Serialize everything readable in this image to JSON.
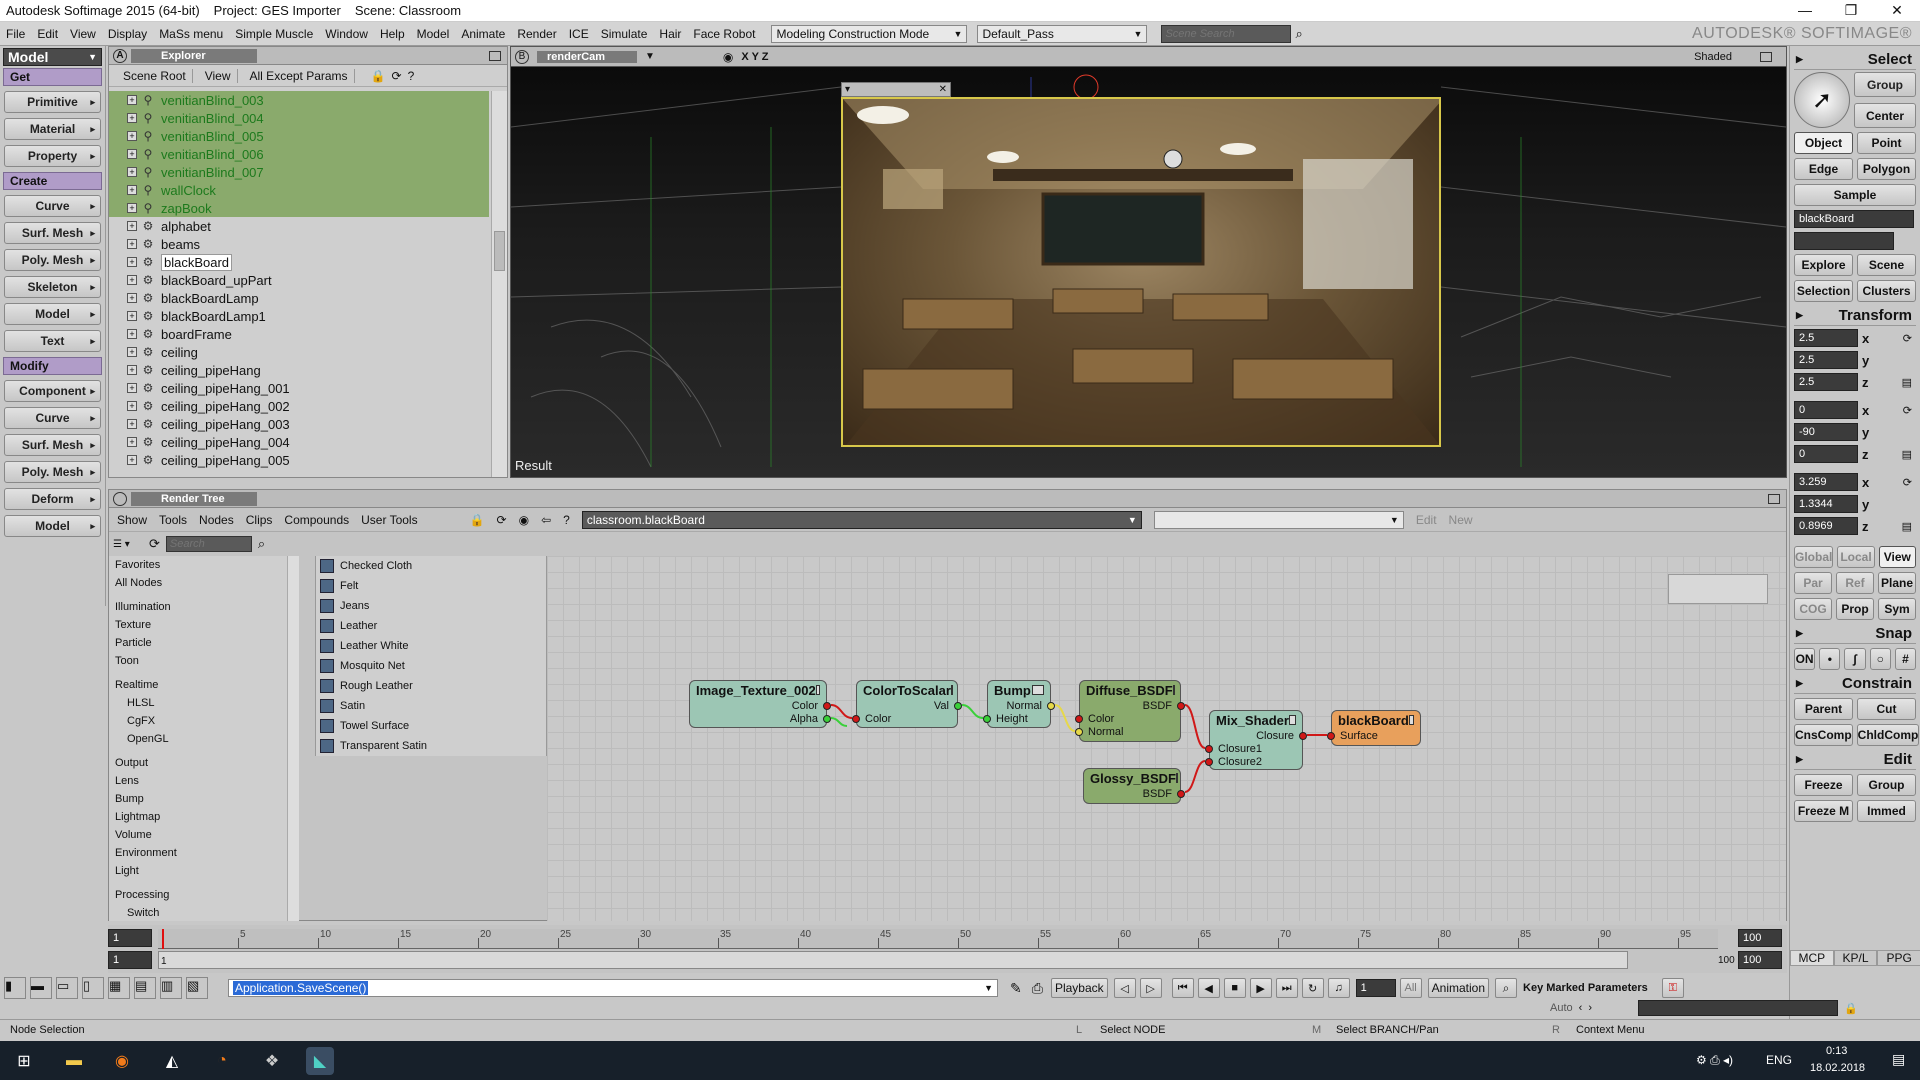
{
  "titlebar": {
    "app": "Autodesk Softimage 2015 (64-bit)",
    "project": "Project: GES Importer",
    "scene": "Scene: Classroom",
    "minimize": "—",
    "maximize": "❐",
    "close": "✕"
  },
  "menubar": {
    "items": [
      "File",
      "Edit",
      "View",
      "Display",
      "MaSs menu",
      "Simple Muscle",
      "Window",
      "Help",
      "Model",
      "Animate",
      "Render",
      "ICE",
      "Simulate",
      "Hair",
      "Face Robot"
    ],
    "mode": "Modeling Construction Mode",
    "pass": "Default_Pass",
    "search_placeholder": "Scene Search",
    "brand": "AUTODESK® SOFTIMAGE®"
  },
  "leftbar": {
    "model_label": "Model",
    "get_label": "Get",
    "get_items": [
      "Primitive",
      "Material",
      "Property"
    ],
    "create_label": "Create",
    "create_items": [
      "Curve",
      "Surf. Mesh",
      "Poly. Mesh",
      "Skeleton",
      "Model",
      "Text"
    ],
    "modify_label": "Modify",
    "modify_items": [
      "Component",
      "Curve",
      "Surf. Mesh",
      "Poly. Mesh",
      "Deform",
      "Model"
    ]
  },
  "explorer": {
    "letter": "A",
    "title": "Explorer",
    "toolbar": [
      "Scene Root",
      "View",
      "All Except Params"
    ],
    "items": [
      {
        "label": "venitianBlind_003",
        "green": true
      },
      {
        "label": "venitianBlind_004",
        "green": true
      },
      {
        "label": "venitianBlind_005",
        "green": true
      },
      {
        "label": "venitianBlind_006",
        "green": true
      },
      {
        "label": "venitianBlind_007",
        "green": true
      },
      {
        "label": "wallClock",
        "green": true
      },
      {
        "label": "zapBook",
        "green": true
      },
      {
        "label": "alphabet",
        "green": false
      },
      {
        "label": "beams",
        "green": false
      },
      {
        "label": "blackBoard",
        "green": false,
        "selected": true
      },
      {
        "label": "blackBoard_upPart",
        "green": false
      },
      {
        "label": "blackBoardLamp",
        "green": false
      },
      {
        "label": "blackBoardLamp1",
        "green": false
      },
      {
        "label": "boardFrame",
        "green": false
      },
      {
        "label": "ceiling",
        "green": false
      },
      {
        "label": "ceiling_pipeHang",
        "green": false
      },
      {
        "label": "ceiling_pipeHang_001",
        "green": false
      },
      {
        "label": "ceiling_pipeHang_002",
        "green": false
      },
      {
        "label": "ceiling_pipeHang_003",
        "green": false
      },
      {
        "label": "ceiling_pipeHang_004",
        "green": false
      },
      {
        "label": "ceiling_pipeHang_005",
        "green": false
      }
    ]
  },
  "viewport": {
    "letter": "B",
    "camera": "renderCam",
    "axes": "X Y Z",
    "shading": "Shaded",
    "result_label": "Result"
  },
  "rendertree": {
    "title": "Render Tree",
    "menu": [
      "Show",
      "Tools",
      "Nodes",
      "Clips",
      "Compounds",
      "User Tools"
    ],
    "path": "classroom.blackBoard",
    "edit_label": "Edit",
    "new_label": "New",
    "search_placeholder": "Search",
    "categories": [
      {
        "label": "Favorites",
        "sub": false,
        "gap": false
      },
      {
        "label": "All Nodes",
        "sub": false,
        "gap": false
      },
      {
        "label": "Illumination",
        "sub": false,
        "gap": true
      },
      {
        "label": "Texture",
        "sub": false,
        "gap": false
      },
      {
        "label": "Particle",
        "sub": false,
        "gap": false
      },
      {
        "label": "Toon",
        "sub": false,
        "gap": false
      },
      {
        "label": "Realtime",
        "sub": false,
        "gap": true
      },
      {
        "label": "HLSL",
        "sub": true,
        "gap": false
      },
      {
        "label": "CgFX",
        "sub": true,
        "gap": false
      },
      {
        "label": "OpenGL",
        "sub": true,
        "gap": false
      },
      {
        "label": "Output",
        "sub": false,
        "gap": true
      },
      {
        "label": "Lens",
        "sub": false,
        "gap": false
      },
      {
        "label": "Bump",
        "sub": false,
        "gap": false
      },
      {
        "label": "Lightmap",
        "sub": false,
        "gap": false
      },
      {
        "label": "Volume",
        "sub": false,
        "gap": false
      },
      {
        "label": "Environment",
        "sub": false,
        "gap": false
      },
      {
        "label": "Light",
        "sub": false,
        "gap": false
      },
      {
        "label": "Processing",
        "sub": false,
        "gap": true
      },
      {
        "label": "Switch",
        "sub": true,
        "gap": false
      }
    ],
    "shaders": [
      "Checked Cloth",
      "Felt",
      "Jeans",
      "Leather",
      "Leather White",
      "Mosquito Net",
      "Rough Leather",
      "Satin",
      "Towel Surface",
      "Transparent Satin"
    ],
    "nodes": {
      "image_texture": {
        "name": "Image_Texture_002",
        "out1": "Color",
        "out2": "Alpha"
      },
      "color_to_scalar": {
        "name": "ColorToScalar",
        "out": "Val",
        "in": "Color"
      },
      "bump": {
        "name": "Bump",
        "out": "Normal",
        "in": "Height"
      },
      "diffuse": {
        "name": "Diffuse_BSDF",
        "out": "BSDF",
        "in1": "Color",
        "in2": "Normal"
      },
      "glossy": {
        "name": "Glossy_BSDF",
        "out": "BSDF"
      },
      "mix": {
        "name": "Mix_Shader",
        "out": "Closure",
        "in1": "Closure1",
        "in2": "Closure2"
      },
      "material": {
        "name": "blackBoard",
        "in": "Surface"
      }
    },
    "colors": {
      "teal": "#9cc6b4",
      "green": "#8aaa6c",
      "orange": "#e8a05c",
      "wire": "#d01818",
      "wire_yellow": "#e6d84a"
    }
  },
  "rightbar": {
    "select_label": "Select",
    "group": "Group",
    "center": "Center",
    "object": "Object",
    "point": "Point",
    "edge": "Edge",
    "polygon": "Polygon",
    "sample": "Sample",
    "selected_name": "blackBoard",
    "explore": "Explore",
    "scene": "Scene",
    "selection": "Selection",
    "clusters": "Clusters",
    "transform_label": "Transform",
    "scale": [
      "2.5",
      "2.5",
      "2.5"
    ],
    "rotate": [
      "0",
      "-90",
      "0"
    ],
    "translate": [
      "3.259",
      "1.3344",
      "0.8969"
    ],
    "axes": [
      "x",
      "y",
      "z"
    ],
    "global": "Global",
    "local": "Local",
    "view": "View",
    "par": "Par",
    "ref": "Ref",
    "plane": "Plane",
    "cog": "COG",
    "prop": "Prop",
    "sym": "Sym",
    "snap_label": "Snap",
    "snap_on": "ON",
    "constrain_label": "Constrain",
    "parent": "Parent",
    "cut": "Cut",
    "cnscomp": "CnsComp",
    "chldcomp": "ChldComp",
    "edit_label": "Edit",
    "freeze": "Freeze",
    "group2": "Group",
    "freeze_m": "Freeze M",
    "immed": "Immed",
    "tabs": [
      "MCP",
      "KP/L",
      "PPG"
    ],
    "key_marked": "Key Marked Parameters"
  },
  "timeline": {
    "start": "1",
    "end": "100",
    "current": "1",
    "end2": "100",
    "ticks": [
      "5",
      "10",
      "15",
      "20",
      "25",
      "30",
      "35",
      "40",
      "45",
      "50",
      "55",
      "60",
      "65",
      "70",
      "75",
      "80",
      "85",
      "90",
      "95"
    ],
    "right_label": "100"
  },
  "cmdbar": {
    "command": "Application.SaveScene()",
    "playback": "Playback",
    "frame": "1",
    "all": "All",
    "animation": "Animation",
    "auto": "Auto"
  },
  "statusbar": {
    "left": "Node Selection",
    "l": "L",
    "l_action": "Select NODE",
    "m": "M",
    "m_action": "Select BRANCH/Pan",
    "r": "R",
    "r_action": "Context Menu"
  },
  "taskbar": {
    "lang": "ENG",
    "time": "0:13",
    "date": "18.02.2018"
  }
}
